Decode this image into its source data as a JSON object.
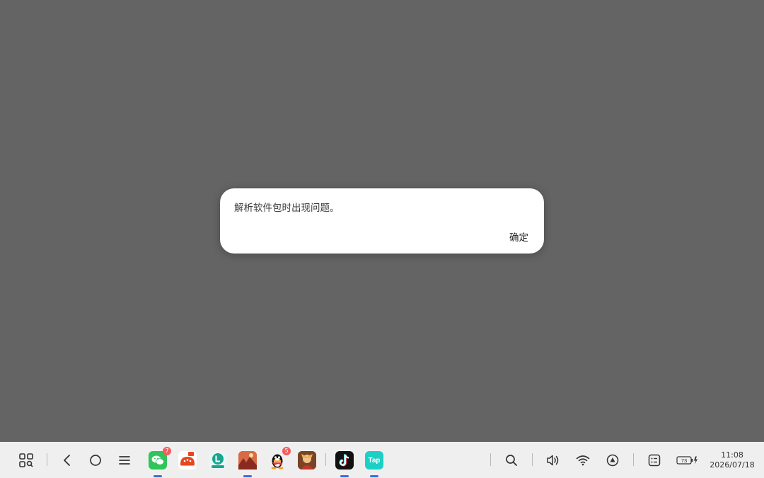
{
  "dialog": {
    "message": "解析软件包时出现问题。",
    "ok_label": "确定"
  },
  "taskbar": {
    "nav_icons": [
      "app-grid-icon",
      "back-icon",
      "home-icon",
      "menu-icon"
    ],
    "apps": [
      {
        "name": "wechat-app-icon",
        "badge": "7",
        "running": true
      },
      {
        "name": "red-app-icon",
        "badge": "",
        "running": false
      },
      {
        "name": "teal-app-icon",
        "badge": "",
        "running": false
      },
      {
        "name": "game-app-icon-1",
        "badge": "",
        "running": true
      },
      {
        "name": "qq-app-icon",
        "badge": "5",
        "running": false
      },
      {
        "name": "game-app-icon-2",
        "badge": "",
        "running": false
      },
      {
        "name": "tiktok-app-icon",
        "badge": "",
        "running": true
      },
      {
        "name": "taptap-app-icon",
        "badge": "",
        "running": true
      }
    ],
    "taptap_label": "Tap",
    "status_icons": [
      "search-icon",
      "volume-icon",
      "wifi-icon",
      "cast-icon",
      "notification-icon"
    ],
    "battery_level": "73",
    "time": "11:08",
    "date": "2026/07/18"
  },
  "colors": {
    "backdrop": "#646464",
    "taskbar": "#efefef",
    "badge": "#f45d5d",
    "running_indicator": "#3a6ee8"
  }
}
